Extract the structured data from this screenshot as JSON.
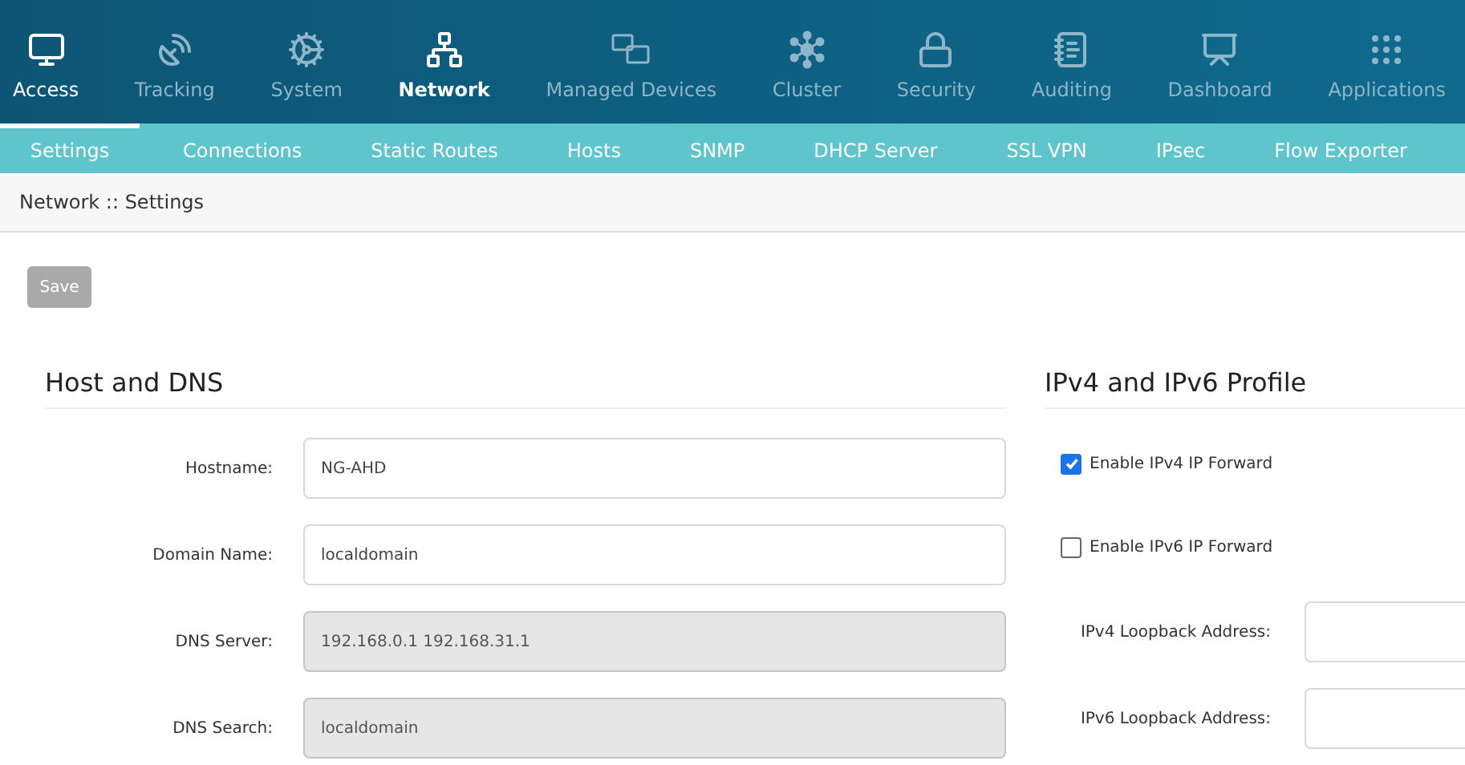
{
  "main_nav": [
    {
      "label": "Access",
      "selected": false,
      "highlighted": true
    },
    {
      "label": "Tracking",
      "selected": false,
      "highlighted": false
    },
    {
      "label": "System",
      "selected": false,
      "highlighted": false
    },
    {
      "label": "Network",
      "selected": true,
      "highlighted": true
    },
    {
      "label": "Managed Devices",
      "selected": false,
      "highlighted": false
    },
    {
      "label": "Cluster",
      "selected": false,
      "highlighted": false
    },
    {
      "label": "Security",
      "selected": false,
      "highlighted": false
    },
    {
      "label": "Auditing",
      "selected": false,
      "highlighted": false
    },
    {
      "label": "Dashboard",
      "selected": false,
      "highlighted": false
    },
    {
      "label": "Applications",
      "selected": false,
      "highlighted": false
    }
  ],
  "sub_nav": [
    {
      "label": "Settings",
      "selected": true
    },
    {
      "label": "Connections",
      "selected": false
    },
    {
      "label": "Static Routes",
      "selected": false
    },
    {
      "label": "Hosts",
      "selected": false
    },
    {
      "label": "SNMP",
      "selected": false
    },
    {
      "label": "DHCP Server",
      "selected": false
    },
    {
      "label": "SSL VPN",
      "selected": false
    },
    {
      "label": "IPsec",
      "selected": false
    },
    {
      "label": "Flow Exporter",
      "selected": false
    }
  ],
  "breadcrumb": "Network :: Settings",
  "save_button": {
    "label": "Save",
    "disabled": true
  },
  "host_dns": {
    "title": "Host and DNS",
    "fields": [
      {
        "label": "Hostname:",
        "value": "NG-AHD",
        "disabled": false
      },
      {
        "label": "Domain Name:",
        "value": "localdomain",
        "disabled": false
      },
      {
        "label": "DNS Server:",
        "value": "192.168.0.1 192.168.31.1",
        "disabled": true
      },
      {
        "label": "DNS Search:",
        "value": "localdomain",
        "disabled": true
      }
    ]
  },
  "ip_profile": {
    "title": "IPv4 and IPv6 Profile",
    "options": [
      {
        "kind": "checkbox",
        "label": "Enable IPv4 IP Forward",
        "checked": true
      },
      {
        "kind": "checkbox",
        "label": "Enable IPv6 IP Forward",
        "checked": false
      },
      {
        "kind": "field",
        "label": "IPv4 Loopback Address:"
      },
      {
        "kind": "field",
        "label": "IPv6 Loopback Address:"
      }
    ]
  }
}
